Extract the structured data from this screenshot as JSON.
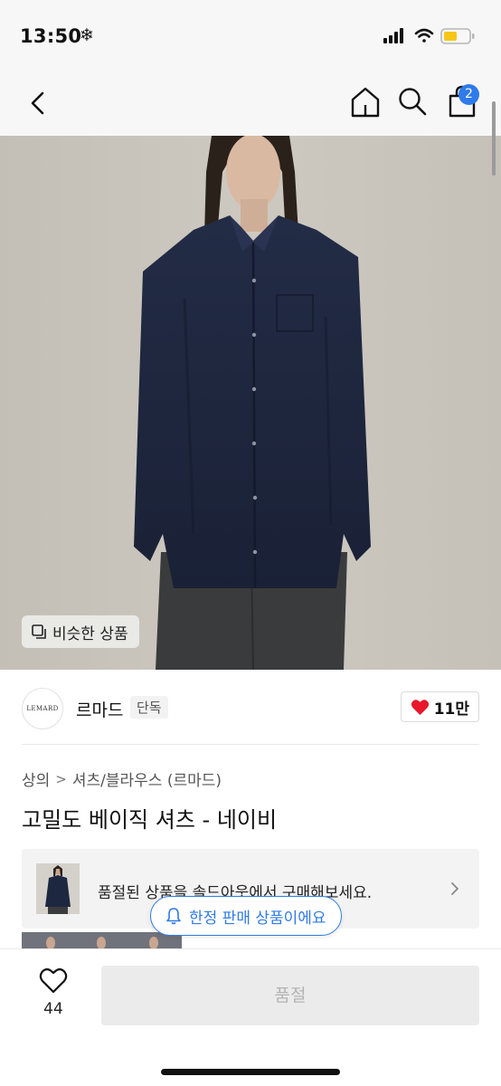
{
  "status_bar": {
    "time": "13:50",
    "snow_glyph": "❄"
  },
  "nav": {
    "bag_count": "2"
  },
  "product_image": {
    "similar_label": "비슷한 상품"
  },
  "brand": {
    "logo_text": "LEMARD",
    "name": "르마드",
    "tag": "단독",
    "likes": "11만"
  },
  "breadcrumb": {
    "category": "상의",
    "separator": ">",
    "subcategory": "셔츠/블라우스 (르마드)"
  },
  "product": {
    "title": "고밀도 베이직 셔츠 - 네이비"
  },
  "soldout_banner": {
    "text": "품절된 상품을 솔드아웃에서 구매해보세요."
  },
  "limited_pill": {
    "text": "한정 판매 상품이에요"
  },
  "bottom_bar": {
    "like_count": "44",
    "buy_label": "품절"
  },
  "colors": {
    "accent": "#2f7bea",
    "heart": "#e8172b",
    "shirt": "#1e2740"
  }
}
